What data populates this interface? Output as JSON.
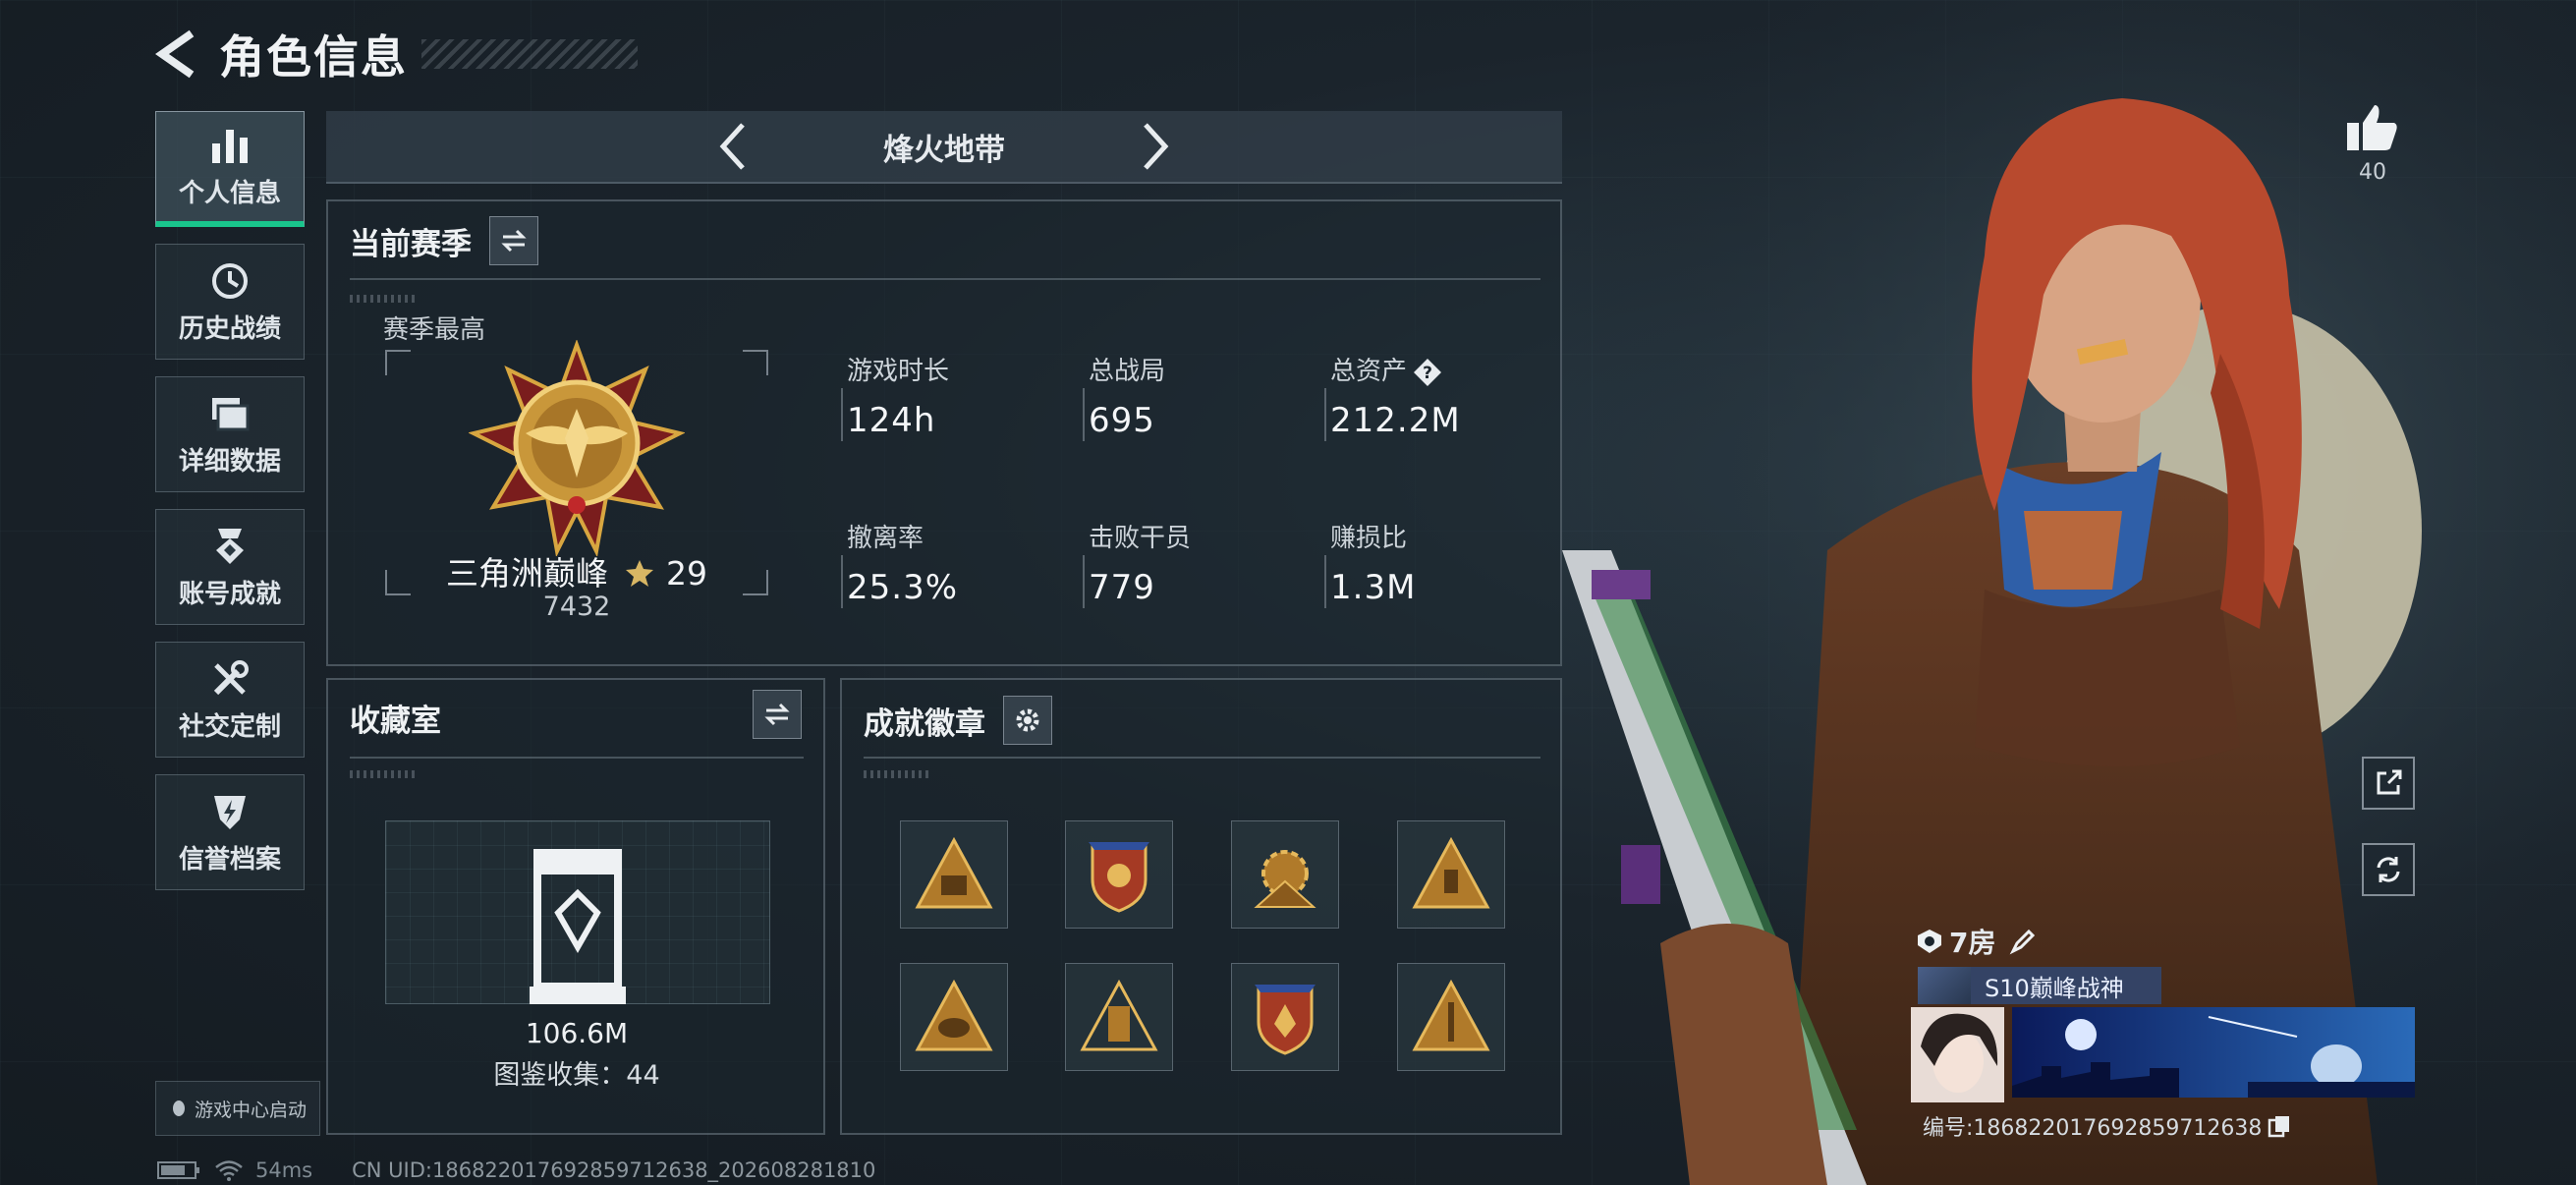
{
  "header": {
    "title": "角色信息"
  },
  "sidebar": {
    "items": [
      {
        "label": "个人信息",
        "icon": "bar-chart-icon",
        "active": true
      },
      {
        "label": "历史战绩",
        "icon": "history-icon"
      },
      {
        "label": "详细数据",
        "icon": "folder-icon"
      },
      {
        "label": "账号成就",
        "icon": "achievement-icon"
      },
      {
        "label": "社交定制",
        "icon": "tools-icon"
      },
      {
        "label": "信誉档案",
        "icon": "credit-icon"
      }
    ],
    "game_center": "游戏中心启动"
  },
  "mode": {
    "title": "烽火地带"
  },
  "season": {
    "title": "当前赛季",
    "best_label": "赛季最高",
    "rank_name": "三角洲巅峰",
    "rank_stars": "29",
    "rank_score": "7432",
    "stats": [
      {
        "label": "游戏时长",
        "value": "124h"
      },
      {
        "label": "总战局",
        "value": "695"
      },
      {
        "label": "总资产",
        "value": "212.2M",
        "help_icon": "question-icon"
      },
      {
        "label": "撤离率",
        "value": "25.3%"
      },
      {
        "label": "击败干员",
        "value": "779"
      },
      {
        "label": "赚损比",
        "value": "1.3M"
      }
    ]
  },
  "collection": {
    "title": "收藏室",
    "value": "106.6M",
    "count_text": "图鉴收集：44"
  },
  "achievements": {
    "title": "成就徽章",
    "badge_count": 8
  },
  "profile": {
    "likes": "40",
    "room": "7房",
    "badge_title": "S10巅峰战神",
    "id_text": "编号:1868220176928597126​38"
  },
  "status": {
    "ping": "54ms",
    "uid": "CN UID:186822017692859712638_202608281810"
  },
  "colors": {
    "accent_green": "#19c58c",
    "gold": "#d8a640",
    "hair": "#b84a2e"
  }
}
